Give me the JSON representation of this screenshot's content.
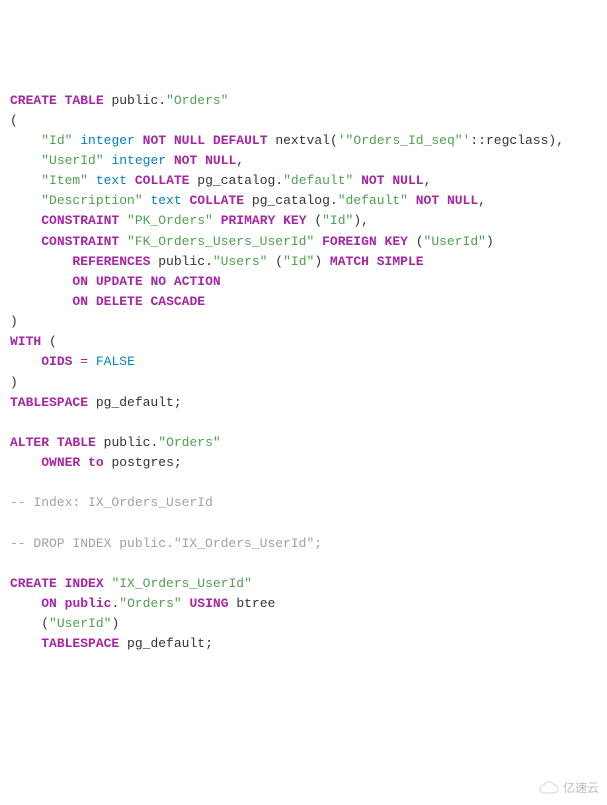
{
  "tokens": [
    {
      "t": "CREATE",
      "c": "kw"
    },
    {
      "t": " "
    },
    {
      "t": "TABLE",
      "c": "kw"
    },
    {
      "t": " "
    },
    {
      "t": "public",
      "c": "def"
    },
    {
      "t": "."
    },
    {
      "t": "\"Orders\"",
      "c": "str"
    },
    {
      "t": "\n"
    },
    {
      "t": "("
    },
    {
      "t": "\n"
    },
    {
      "t": "    "
    },
    {
      "t": "\"Id\" ",
      "c": "str"
    },
    {
      "t": "integer",
      "c": "type"
    },
    {
      "t": " "
    },
    {
      "t": "NOT",
      "c": "kw"
    },
    {
      "t": " "
    },
    {
      "t": "NULL",
      "c": "kw"
    },
    {
      "t": " "
    },
    {
      "t": "DEFAULT",
      "c": "kw"
    },
    {
      "t": " "
    },
    {
      "t": "nextval",
      "c": "def"
    },
    {
      "t": "("
    },
    {
      "t": "'\"Orders_Id_seq\"'",
      "c": "str"
    },
    {
      "t": "::"
    },
    {
      "t": "regclass",
      "c": "def"
    },
    {
      "t": "),"
    },
    {
      "t": "\n"
    },
    {
      "t": "    "
    },
    {
      "t": "\"UserId\" ",
      "c": "str"
    },
    {
      "t": "integer",
      "c": "type"
    },
    {
      "t": " "
    },
    {
      "t": "NOT",
      "c": "kw"
    },
    {
      "t": " "
    },
    {
      "t": "NULL",
      "c": "kw"
    },
    {
      "t": ","
    },
    {
      "t": "\n"
    },
    {
      "t": "    "
    },
    {
      "t": "\"Item\" ",
      "c": "str"
    },
    {
      "t": "text",
      "c": "type"
    },
    {
      "t": " "
    },
    {
      "t": "COLLATE",
      "c": "kw"
    },
    {
      "t": " "
    },
    {
      "t": "pg_catalog",
      "c": "def"
    },
    {
      "t": "."
    },
    {
      "t": "\"default\" ",
      "c": "str"
    },
    {
      "t": "NOT",
      "c": "kw"
    },
    {
      "t": " "
    },
    {
      "t": "NULL",
      "c": "kw"
    },
    {
      "t": ","
    },
    {
      "t": "\n"
    },
    {
      "t": "    "
    },
    {
      "t": "\"Description\" ",
      "c": "str"
    },
    {
      "t": "text",
      "c": "type"
    },
    {
      "t": " "
    },
    {
      "t": "COLLATE",
      "c": "kw"
    },
    {
      "t": " "
    },
    {
      "t": "pg_catalog",
      "c": "def"
    },
    {
      "t": "."
    },
    {
      "t": "\"default\" ",
      "c": "str"
    },
    {
      "t": "NOT",
      "c": "kw"
    },
    {
      "t": " "
    },
    {
      "t": "NULL",
      "c": "kw"
    },
    {
      "t": ","
    },
    {
      "t": "\n"
    },
    {
      "t": "    "
    },
    {
      "t": "CONSTRAINT",
      "c": "kw"
    },
    {
      "t": " "
    },
    {
      "t": "\"PK_Orders\"",
      "c": "str"
    },
    {
      "t": " "
    },
    {
      "t": "PRIMARY",
      "c": "kw"
    },
    {
      "t": " "
    },
    {
      "t": "KEY",
      "c": "kw"
    },
    {
      "t": " ("
    },
    {
      "t": "\"Id\"",
      "c": "str"
    },
    {
      "t": "),"
    },
    {
      "t": "\n"
    },
    {
      "t": "    "
    },
    {
      "t": "CONSTRAINT",
      "c": "kw"
    },
    {
      "t": " "
    },
    {
      "t": "\"FK_Orders_Users_UserId\"",
      "c": "str"
    },
    {
      "t": " "
    },
    {
      "t": "FOREIGN",
      "c": "kw"
    },
    {
      "t": " "
    },
    {
      "t": "KEY",
      "c": "kw"
    },
    {
      "t": " ("
    },
    {
      "t": "\"UserId\"",
      "c": "str"
    },
    {
      "t": ")"
    },
    {
      "t": "\n"
    },
    {
      "t": "        "
    },
    {
      "t": "REFERENCES",
      "c": "kw"
    },
    {
      "t": " "
    },
    {
      "t": "public",
      "c": "def"
    },
    {
      "t": "."
    },
    {
      "t": "\"Users\"",
      "c": "str"
    },
    {
      "t": " ("
    },
    {
      "t": "\"Id\"",
      "c": "str"
    },
    {
      "t": ") "
    },
    {
      "t": "MATCH",
      "c": "kw"
    },
    {
      "t": " "
    },
    {
      "t": "SIMPLE",
      "c": "kw"
    },
    {
      "t": "\n"
    },
    {
      "t": "        "
    },
    {
      "t": "ON",
      "c": "kw"
    },
    {
      "t": " "
    },
    {
      "t": "UPDATE",
      "c": "kw"
    },
    {
      "t": " "
    },
    {
      "t": "NO",
      "c": "kw"
    },
    {
      "t": " "
    },
    {
      "t": "ACTION",
      "c": "kw"
    },
    {
      "t": "\n"
    },
    {
      "t": "        "
    },
    {
      "t": "ON",
      "c": "kw"
    },
    {
      "t": " "
    },
    {
      "t": "DELETE",
      "c": "kw"
    },
    {
      "t": " "
    },
    {
      "t": "CASCADE",
      "c": "kw"
    },
    {
      "t": "\n"
    },
    {
      "t": ")"
    },
    {
      "t": "\n"
    },
    {
      "t": "WITH",
      "c": "kw"
    },
    {
      "t": " ("
    },
    {
      "t": "\n"
    },
    {
      "t": "    "
    },
    {
      "t": "OIDS",
      "c": "kw"
    },
    {
      "t": " "
    },
    {
      "t": "=",
      "c": "op"
    },
    {
      "t": " "
    },
    {
      "t": "FALSE",
      "c": "type"
    },
    {
      "t": "\n"
    },
    {
      "t": ")"
    },
    {
      "t": "\n"
    },
    {
      "t": "TABLESPACE",
      "c": "kw"
    },
    {
      "t": " "
    },
    {
      "t": "pg_default",
      "c": "def"
    },
    {
      "t": ";"
    },
    {
      "t": "\n"
    },
    {
      "t": "\n"
    },
    {
      "t": "ALTER",
      "c": "kw"
    },
    {
      "t": " "
    },
    {
      "t": "TABLE",
      "c": "kw"
    },
    {
      "t": " "
    },
    {
      "t": "public",
      "c": "def"
    },
    {
      "t": "."
    },
    {
      "t": "\"Orders\"",
      "c": "str"
    },
    {
      "t": "\n"
    },
    {
      "t": "    "
    },
    {
      "t": "OWNER",
      "c": "kw"
    },
    {
      "t": " "
    },
    {
      "t": "to",
      "c": "kw"
    },
    {
      "t": " "
    },
    {
      "t": "postgres",
      "c": "def"
    },
    {
      "t": ";"
    },
    {
      "t": "\n"
    },
    {
      "t": "\n"
    },
    {
      "t": "-- Index: IX_Orders_UserId",
      "c": "cmt"
    },
    {
      "t": "\n"
    },
    {
      "t": "\n"
    },
    {
      "t": "-- DROP INDEX public.\"IX_Orders_UserId\";",
      "c": "cmt"
    },
    {
      "t": "\n"
    },
    {
      "t": "\n"
    },
    {
      "t": "CREATE",
      "c": "kw"
    },
    {
      "t": " "
    },
    {
      "t": "INDEX",
      "c": "kw"
    },
    {
      "t": " "
    },
    {
      "t": "\"IX_Orders_UserId\"",
      "c": "str"
    },
    {
      "t": "\n"
    },
    {
      "t": "    "
    },
    {
      "t": "ON",
      "c": "kw"
    },
    {
      "t": " "
    },
    {
      "t": "public",
      "c": "kw"
    },
    {
      "t": "."
    },
    {
      "t": "\"Orders\"",
      "c": "str"
    },
    {
      "t": " "
    },
    {
      "t": "USING",
      "c": "kw"
    },
    {
      "t": " "
    },
    {
      "t": "btree",
      "c": "def"
    },
    {
      "t": "\n"
    },
    {
      "t": "    ("
    },
    {
      "t": "\"UserId\"",
      "c": "str"
    },
    {
      "t": ")"
    },
    {
      "t": "\n"
    },
    {
      "t": "    "
    },
    {
      "t": "TABLESPACE",
      "c": "kw"
    },
    {
      "t": " "
    },
    {
      "t": "pg_default",
      "c": "def"
    },
    {
      "t": ";"
    }
  ],
  "watermark": "亿速云"
}
